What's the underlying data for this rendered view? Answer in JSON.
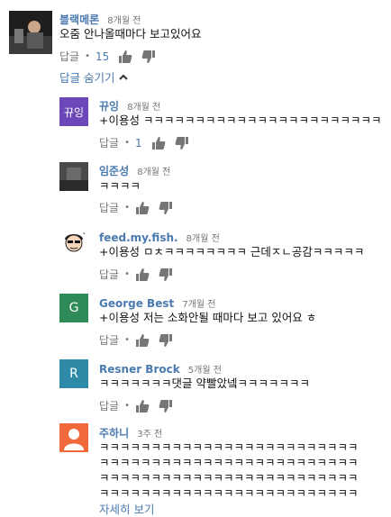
{
  "top_comment": {
    "author": "블랙메론",
    "time": "8개월 전",
    "text": "오줌 안나올때마다 보고있어요",
    "reply_label": "답글",
    "likes": "15"
  },
  "hide_replies_label": "답글 숨기기",
  "replies": [
    {
      "author": "뀨잉",
      "time": "8개월 전",
      "avatar_text": "뀨잉",
      "avatar_color": "#6b47b8",
      "text_lines": [
        "+이용성 ㅋㅋㅋㅋㅋㅋㅋㅋㅋㅋㅋㅋㅋㅋㅋㅋㅋㅋㅋㅋㅋㅋㅋ"
      ],
      "reply_label": "답글",
      "likes": "1"
    },
    {
      "author": "임준성",
      "time": "8개월 전",
      "avatar_text": "",
      "avatar_color": "#3a3a3a",
      "text_lines": [
        "ㅋㅋㅋㅋ"
      ],
      "reply_label": "답글",
      "likes": ""
    },
    {
      "author": "feed.my.fish.",
      "time": "8개월 전",
      "avatar_text": "",
      "avatar_color": "#ffffff",
      "text_lines": [
        "+이용성 ㅁㅊㅋㅋㅋㅋㅋㅋㅋㅋ 근데ㅈㄴ공감ㅋㅋㅋㅋㅋ"
      ],
      "reply_label": "답글",
      "likes": ""
    },
    {
      "author": "George Best",
      "time": "7개월 전",
      "avatar_text": "G",
      "avatar_color": "#2e8b57",
      "text_lines": [
        "+이용성 저는 소화안될 때마다 보고 있어요 ㅎ"
      ],
      "reply_label": "답글",
      "likes": ""
    },
    {
      "author": "Resner Brock",
      "time": "5개월 전",
      "avatar_text": "R",
      "avatar_color": "#2f8aa8",
      "text_lines": [
        "ㅋㅋㅋㅋㅋㅋㅋ댓글 약빨았넼ㅋㅋㅋㅋㅋㅋㅋ"
      ],
      "reply_label": "답글",
      "likes": ""
    },
    {
      "author": "주하니",
      "time": "3주 전",
      "avatar_text": "",
      "avatar_color": "#f06a3c",
      "text_lines": [
        "ㅋㅋㅋㅋㅋㅋㅋㅋㅋㅋㅋㅋㅋㅋㅋㅋㅋㅋㅋㅋㅋㅋㅋㅋㅋ",
        "ㅋㅋㅋㅋㅋㅋㅋㅋㅋㅋㅋㅋㅋㅋㅋㅋㅋㅋㅋㅋㅋㅋㅋㅋㅋ",
        "ㅋㅋㅋㅋㅋㅋㅋㅋㅋㅋㅋㅋㅋㅋㅋㅋㅋㅋㅋㅋㅋㅋㅋㅋㅋ",
        "ㅋㅋㅋㅋㅋㅋㅋㅋㅋㅋㅋㅋㅋㅋㅋㅋㅋㅋㅋㅋㅋㅋㅋㅋㅋ"
      ],
      "reply_label": "",
      "likes": ""
    }
  ],
  "show_more_label": "자세히 보기"
}
